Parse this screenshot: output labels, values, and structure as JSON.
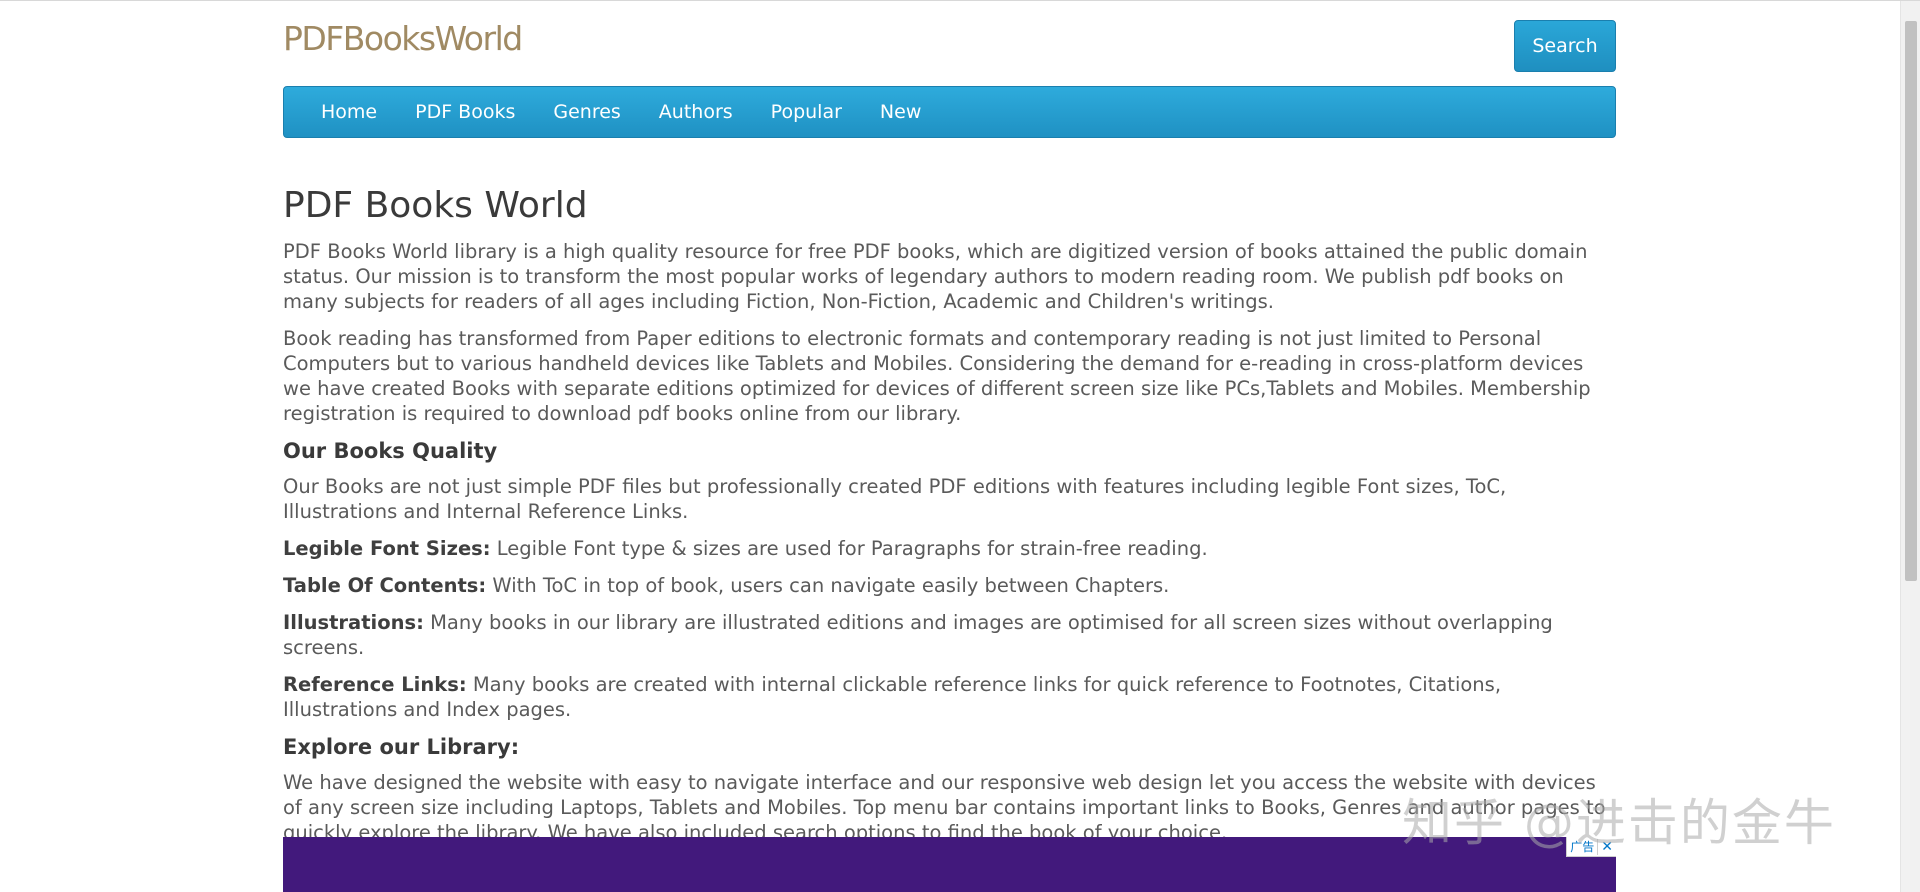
{
  "header": {
    "logo_text": "PDFBooksWorld",
    "search_label": "Search"
  },
  "nav": {
    "items": [
      {
        "label": "Home"
      },
      {
        "label": "PDF Books"
      },
      {
        "label": "Genres"
      },
      {
        "label": "Authors"
      },
      {
        "label": "Popular"
      },
      {
        "label": "New"
      }
    ]
  },
  "main": {
    "title": "PDF Books World",
    "intro_1": "PDF Books World library is a high quality resource for free PDF books, which are digitized version of books attained the public domain status. Our mission is to transform the most popular works of legendary authors to modern reading room. We publish pdf books on many subjects for readers of all ages including Fiction, Non-Fiction, Academic and Children's writings.",
    "intro_2": "Book reading has transformed from Paper editions to electronic formats and contemporary reading is not just limited to Personal Computers but to various handheld devices like Tablets and Mobiles. Considering the demand for e-reading in cross-platform devices we have created Books with separate editions optimized for devices of different screen size like PCs,Tablets and Mobiles. Membership registration is required to download pdf books online from our library.",
    "quality_heading": "Our Books Quality",
    "quality_text": "Our Books are not just simple PDF files but professionally created PDF editions with features including legible Font sizes, ToC, Illustrations and Internal Reference Links.",
    "features": [
      {
        "label": "Legible Font Sizes:",
        "text": " Legible Font type & sizes are used for Paragraphs for strain-free reading."
      },
      {
        "label": "Table Of Contents:",
        "text": " With ToC in top of book, users can navigate easily between Chapters."
      },
      {
        "label": "Illustrations:",
        "text": " Many books in our library are illustrated editions and images are optimised for all screen sizes without overlapping screens."
      },
      {
        "label": "Reference Links:",
        "text": "  Many books are created with internal clickable reference links for quick reference to  Footnotes, Citations, Illustrations and Index pages."
      }
    ],
    "explore_heading": "Explore our Library:",
    "explore_text": "We have designed the website with easy to navigate interface  and our responsive web design let you access the website with devices of any screen size including Laptops, Tablets and Mobiles. Top menu bar contains important links to Books, Genres and author pages to quickly explore the library. We have also included search options to find the book of your choice."
  },
  "ad": {
    "tag_label": "广告",
    "close_symbol": "✕",
    "background_color": "#42197c"
  },
  "watermark": {
    "text": "知乎 @进击的金牛"
  },
  "colors": {
    "accent": "#2196c9",
    "logo": "#a08a63"
  }
}
